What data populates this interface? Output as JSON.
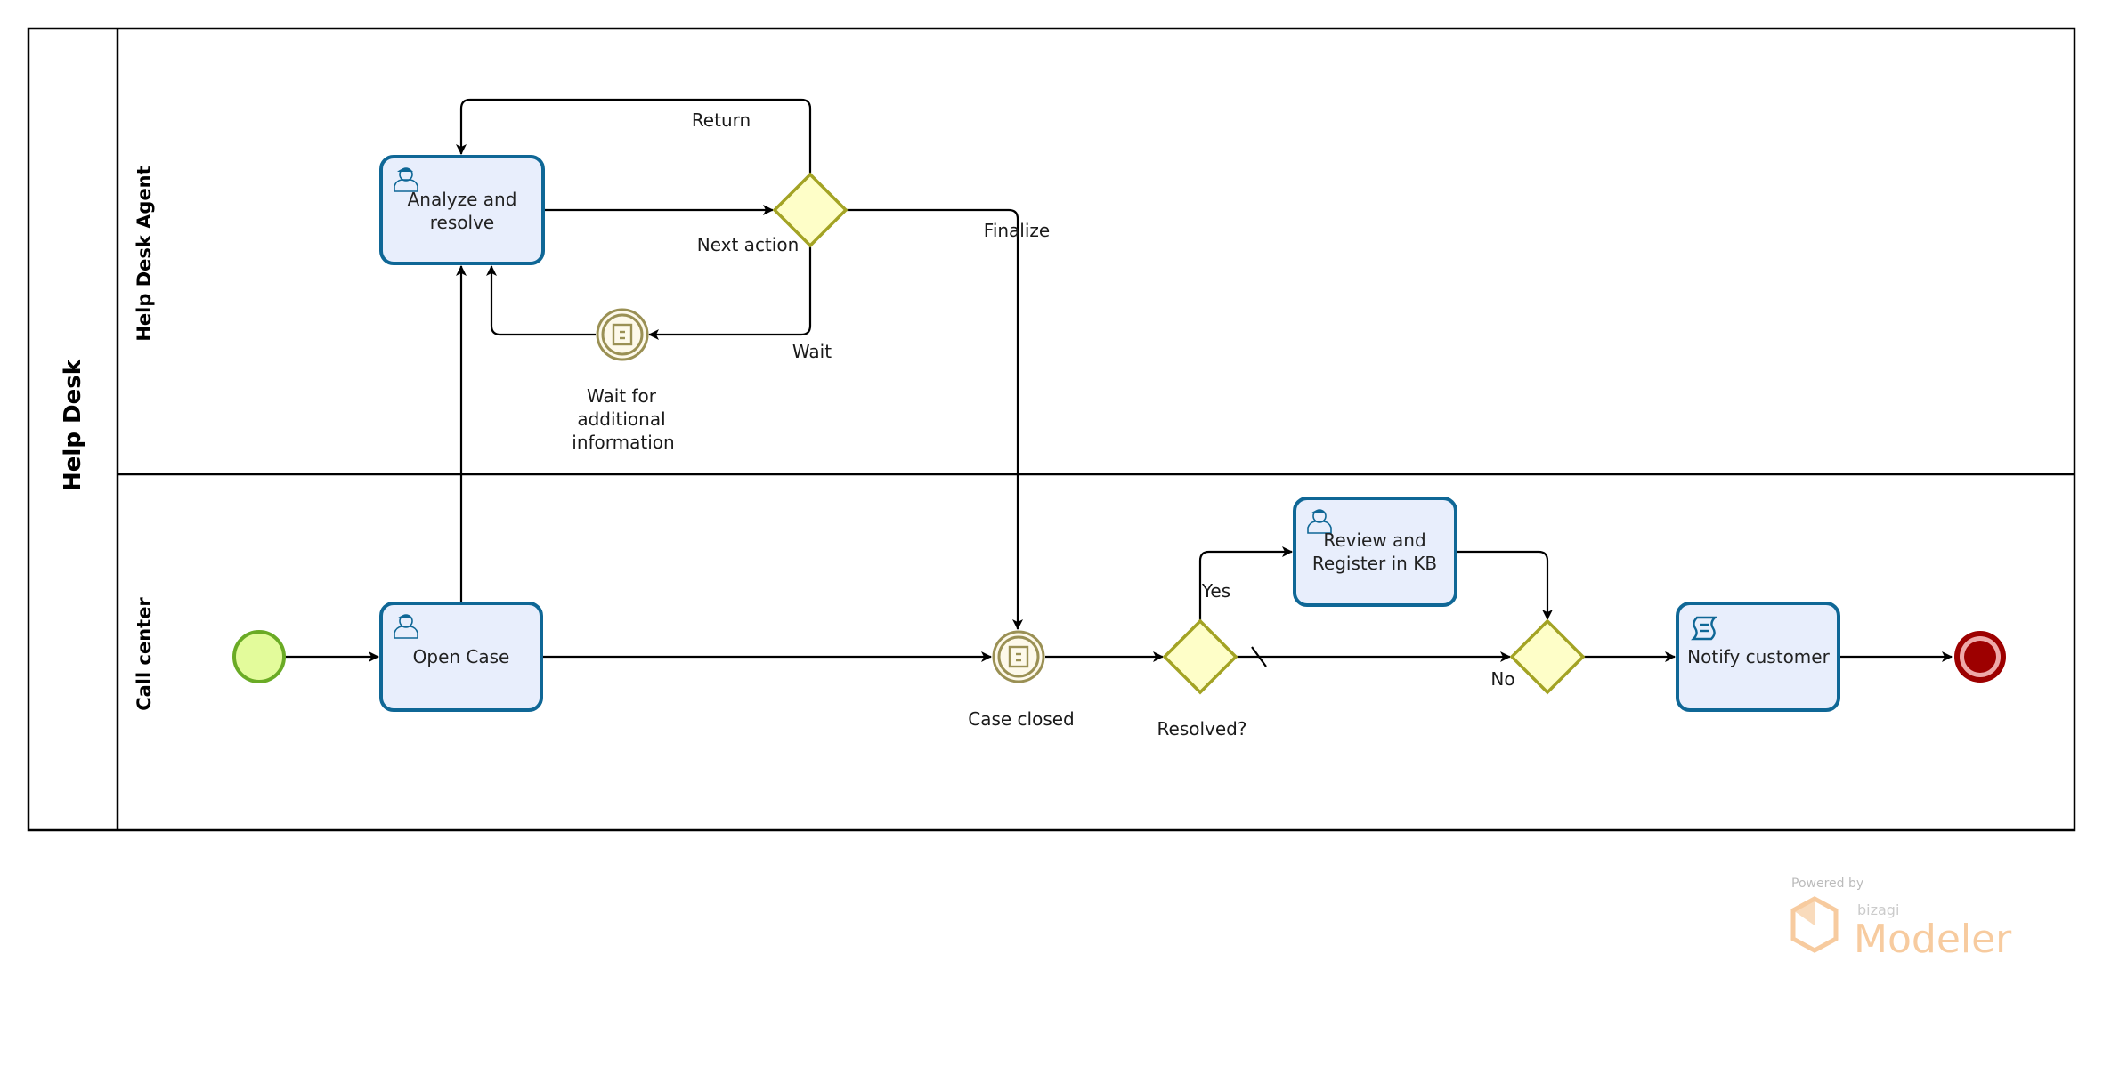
{
  "pool": {
    "label": "Help Desk"
  },
  "lanes": [
    {
      "id": "agent",
      "label": "Help Desk Agent"
    },
    {
      "id": "callcenter",
      "label": "Call center"
    }
  ],
  "tasks": {
    "analyze": {
      "lines": [
        "Analyze and",
        "resolve"
      ],
      "type": "user",
      "icon": "user-icon"
    },
    "open": {
      "lines": [
        "Open Case"
      ],
      "type": "user",
      "icon": "user-icon"
    },
    "review": {
      "lines": [
        "Review and",
        "Register in KB"
      ],
      "type": "user",
      "icon": "user-icon"
    },
    "notify": {
      "lines": [
        "Notify customer"
      ],
      "type": "script",
      "icon": "script-icon"
    }
  },
  "events": {
    "start": {
      "type": "start"
    },
    "wait_info": {
      "type": "intermediate-conditional",
      "lines": [
        "Wait for",
        "additional",
        "information"
      ]
    },
    "case_closed": {
      "type": "intermediate-conditional",
      "lines": [
        "Case closed"
      ]
    },
    "end": {
      "type": "end"
    }
  },
  "gateways": {
    "next_action": {
      "label": "Next action"
    },
    "resolved": {
      "label": "Resolved?"
    },
    "merge": {
      "label": ""
    }
  },
  "flows": {
    "return": "Return",
    "wait": "Wait",
    "finalize": "Finalize",
    "yes": "Yes",
    "no": "No"
  },
  "colors": {
    "task_fill": "#e8eefc",
    "task_stroke": "#0f6796",
    "gateway_fill": "#fefec8",
    "gateway_stroke": "#a3a324",
    "event_int_fill": "#fdf9ea",
    "event_int_stroke": "#9a9054",
    "start_fill": "#e3fb9b",
    "start_stroke": "#6aab25",
    "end_outer": "#9d0000",
    "end_ring": "#eea9a9",
    "watermark": "#f7c99a"
  },
  "watermark": {
    "powered": "Powered by",
    "brand_small": "bizagi",
    "brand_big": "Modeler"
  }
}
